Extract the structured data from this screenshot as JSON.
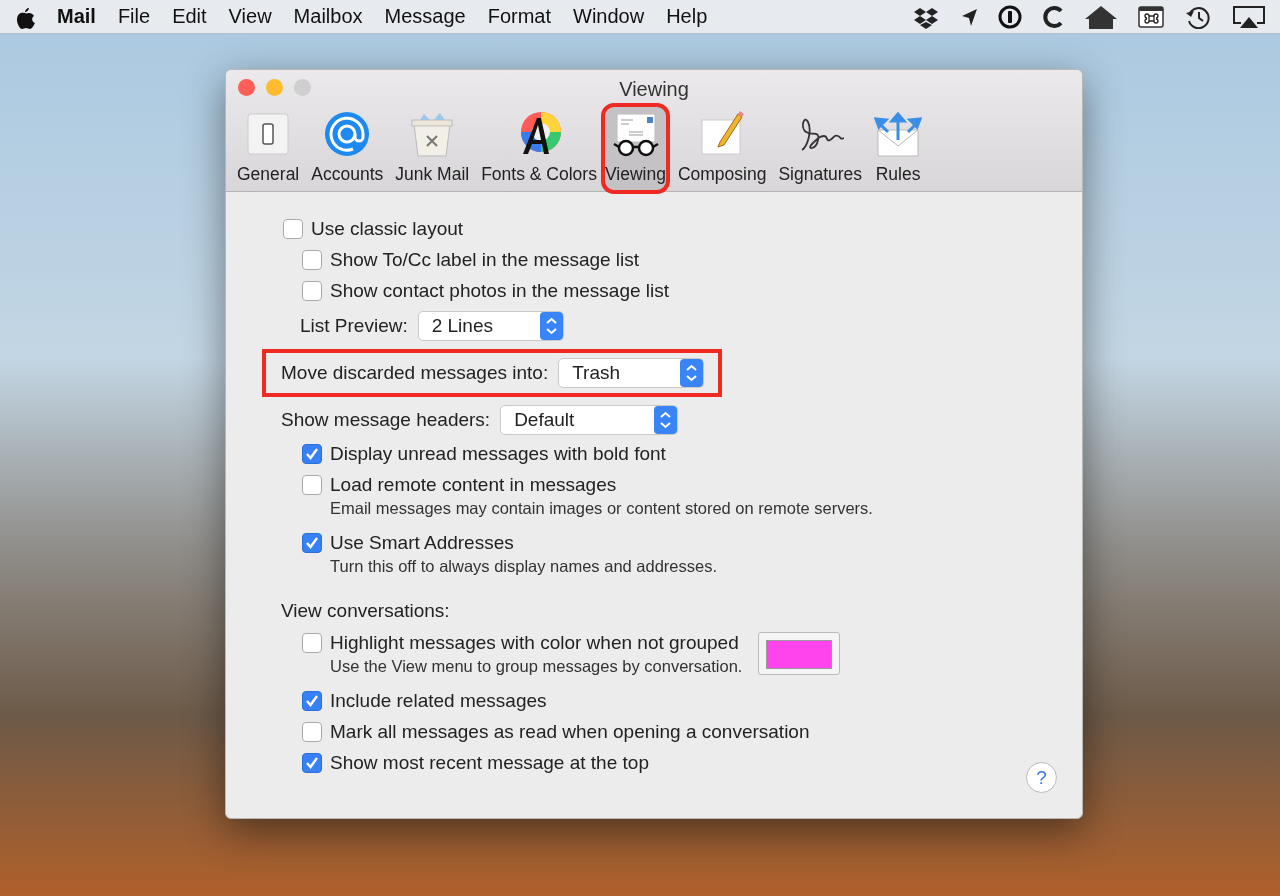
{
  "menu_bar": {
    "items": [
      {
        "label": "Mail",
        "kind": "app"
      },
      {
        "label": "File",
        "kind": "menu"
      },
      {
        "label": "Edit",
        "kind": "menu"
      },
      {
        "label": "View",
        "kind": "menu"
      },
      {
        "label": "Mailbox",
        "kind": "menu"
      },
      {
        "label": "Message",
        "kind": "menu"
      },
      {
        "label": "Format",
        "kind": "menu"
      },
      {
        "label": "Window",
        "kind": "menu"
      },
      {
        "label": "Help",
        "kind": "menu"
      }
    ]
  },
  "window": {
    "title": "Viewing",
    "toolbar": [
      {
        "label": "General",
        "kind": "general",
        "selected": false,
        "highlighted": false
      },
      {
        "label": "Accounts",
        "kind": "accounts",
        "selected": false,
        "highlighted": false
      },
      {
        "label": "Junk Mail",
        "kind": "junk",
        "selected": false,
        "highlighted": false
      },
      {
        "label": "Fonts & Colors",
        "kind": "fonts",
        "selected": false,
        "highlighted": false
      },
      {
        "label": "Viewing",
        "kind": "viewing",
        "selected": true,
        "highlighted": true
      },
      {
        "label": "Composing",
        "kind": "composing",
        "selected": false,
        "highlighted": false
      },
      {
        "label": "Signatures",
        "kind": "signatures",
        "selected": false,
        "highlighted": false
      },
      {
        "label": "Rules",
        "kind": "rules",
        "selected": false,
        "highlighted": false
      }
    ],
    "settings": [
      {
        "kind": "checkbox",
        "label": "Use classic layout",
        "checked": false,
        "children": [
          {
            "kind": "checkbox",
            "label": "Show To/Cc label in the message list",
            "checked": false
          },
          {
            "kind": "checkbox",
            "label": "Show contact photos in the message list",
            "checked": false
          },
          {
            "kind": "popup",
            "label": "List Preview:",
            "value": "2 Lines",
            "highlighted": false
          }
        ]
      },
      {
        "kind": "popup",
        "label": "Move discarded messages into:",
        "value": "Trash",
        "highlighted": true
      },
      {
        "kind": "popup",
        "label": "Show message headers:",
        "value": "Default",
        "highlighted": false,
        "children": [
          {
            "kind": "checkbox",
            "label": "Display unread messages with bold font",
            "checked": true
          },
          {
            "kind": "checkbox",
            "label": "Load remote content in messages",
            "checked": false,
            "note": "Email messages may contain images or content stored on remote servers."
          },
          {
            "kind": "checkbox",
            "label": "Use Smart Addresses",
            "checked": true,
            "note": "Turn this off to always display names and addresses."
          }
        ]
      },
      {
        "kind": "heading",
        "label": "View conversations:",
        "children": [
          {
            "kind": "checkbox",
            "label": "Highlight messages with color when not grouped",
            "checked": false,
            "note": "Use the View menu to group messages by conversation.",
            "color": "#ff44ee"
          },
          {
            "kind": "checkbox",
            "label": "Include related messages",
            "checked": true
          },
          {
            "kind": "checkbox",
            "label": "Mark all messages as read when opening a conversation",
            "checked": false
          },
          {
            "kind": "checkbox",
            "label": "Show most recent message at the top",
            "checked": true
          }
        ]
      }
    ],
    "help_button": "?"
  }
}
